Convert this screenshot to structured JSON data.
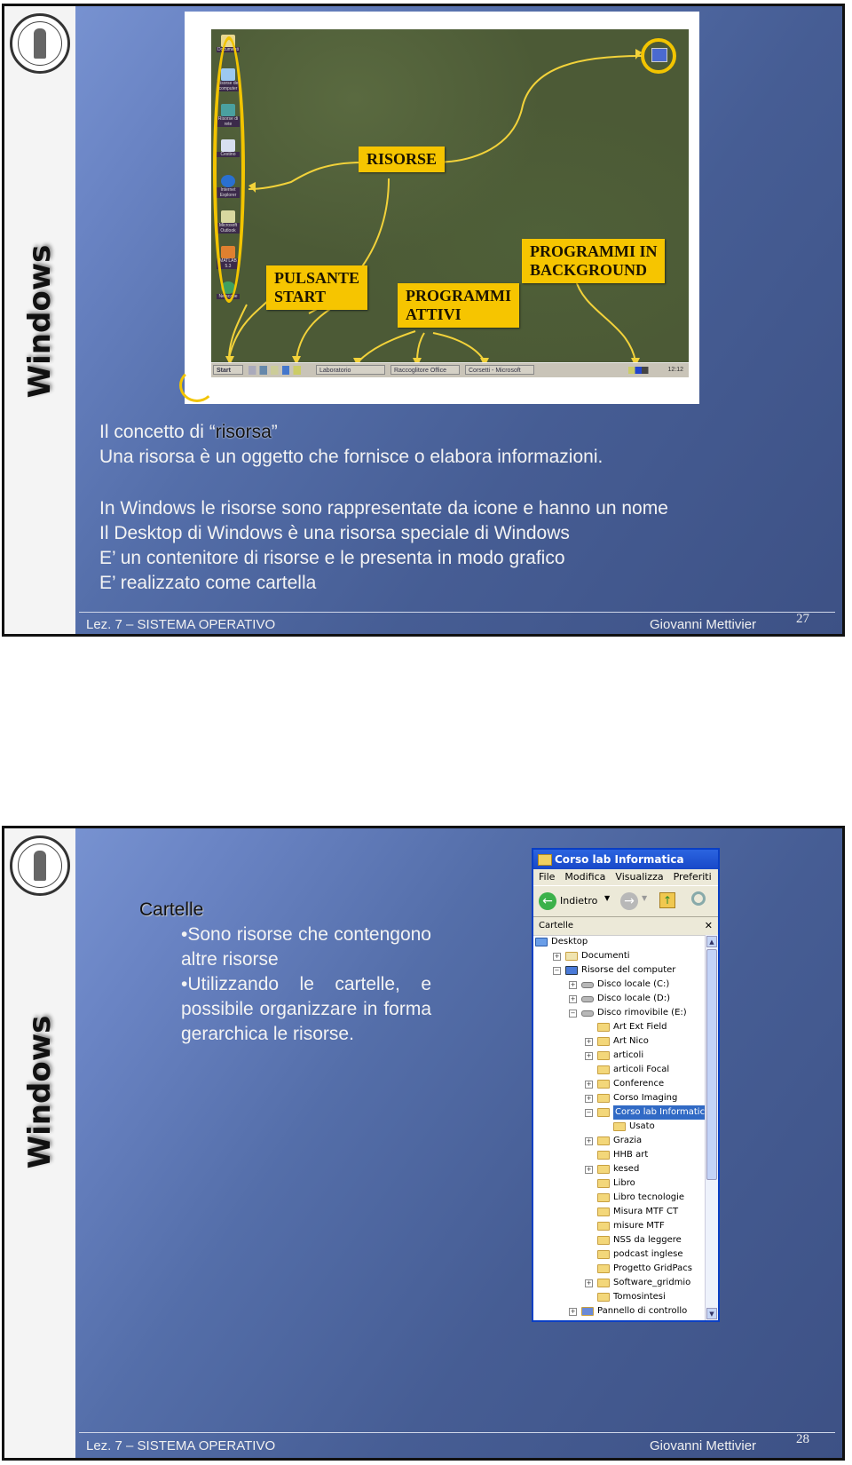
{
  "slides": [
    {
      "side_title": "Windows",
      "desktop": {
        "labels": {
          "risorse": "RISORSE",
          "pulsante_start": [
            "PULSANTE",
            "START"
          ],
          "programmi_attivi": [
            "PROGRAMMI",
            "ATTIVI"
          ],
          "programmi_background": [
            "PROGRAMMI IN",
            "BACKGROUND"
          ]
        },
        "icons": [
          "Documenti",
          "Risorse del computer",
          "Risorse di rete",
          "Cestino",
          "Internet Explorer",
          "Microsoft Outlook",
          "MATLAB 5.3",
          "Netscape"
        ],
        "taskbar": {
          "start": "Start",
          "buttons": [
            "Laboratorio",
            "Raccoglitore Office",
            "Corsetti - Microsoft"
          ],
          "clock": "12:12"
        }
      },
      "concept": {
        "prefix": "Il concetto di ",
        "open_quote": "“",
        "word": "risorsa",
        "close_quote": "”",
        "definition": "Una risorsa è un oggetto che fornisce o elabora informazioni."
      },
      "lines": [
        "In Windows le risorse sono rappresentate da icone e hanno un nome",
        "Il Desktop di Windows è una risorsa speciale di Windows",
        "E’ un contenitore di risorse e le presenta in modo grafico",
        "E’ realizzato come cartella"
      ],
      "footer": {
        "left": "Lez. 7 – SISTEMA OPERATIVO",
        "right": "Giovanni Mettivier",
        "page": "27"
      }
    },
    {
      "side_title": "Windows",
      "heading": "Cartelle",
      "bullets": [
        "•Sono risorse che contengono altre risorse",
        "•Utilizzando le cartelle, e possibile organizzare in forma gerarchica le risorse."
      ],
      "explorer": {
        "title": "Corso lab Informatica",
        "menu": [
          "File",
          "Modifica",
          "Visualizza",
          "Preferiti"
        ],
        "back_label": "Indietro",
        "pane_title": "Cartelle",
        "tree": [
          {
            "label": "Desktop",
            "level": 0,
            "expander": "",
            "icon": "desk"
          },
          {
            "label": "Documenti",
            "level": 1,
            "expander": "+",
            "icon": "docs"
          },
          {
            "label": "Risorse del computer",
            "level": 1,
            "expander": "−",
            "icon": "comp"
          },
          {
            "label": "Disco locale (C:)",
            "level": 2,
            "expander": "+",
            "icon": "drive"
          },
          {
            "label": "Disco locale (D:)",
            "level": 2,
            "expander": "+",
            "icon": "drive"
          },
          {
            "label": "Disco rimovibile (E:)",
            "level": 2,
            "expander": "−",
            "icon": "drive"
          },
          {
            "label": "Art Ext Field",
            "level": 3,
            "expander": "",
            "icon": "folder"
          },
          {
            "label": "Art Nico",
            "level": 3,
            "expander": "+",
            "icon": "folder"
          },
          {
            "label": "articoli",
            "level": 3,
            "expander": "+",
            "icon": "folder"
          },
          {
            "label": "articoli Focal",
            "level": 3,
            "expander": "",
            "icon": "folder"
          },
          {
            "label": "Conference",
            "level": 3,
            "expander": "+",
            "icon": "folder"
          },
          {
            "label": "Corso Imaging",
            "level": 3,
            "expander": "+",
            "icon": "folder"
          },
          {
            "label": "Corso lab Informatica",
            "level": 3,
            "expander": "−",
            "icon": "folder",
            "selected": true
          },
          {
            "label": "Usato",
            "level": 4,
            "expander": "",
            "icon": "folder"
          },
          {
            "label": "Grazia",
            "level": 3,
            "expander": "+",
            "icon": "folder"
          },
          {
            "label": "HHB art",
            "level": 3,
            "expander": "",
            "icon": "folder"
          },
          {
            "label": "kesed",
            "level": 3,
            "expander": "+",
            "icon": "folder"
          },
          {
            "label": "Libro",
            "level": 3,
            "expander": "",
            "icon": "folder"
          },
          {
            "label": "Libro tecnologie",
            "level": 3,
            "expander": "",
            "icon": "folder"
          },
          {
            "label": "Misura MTF CT",
            "level": 3,
            "expander": "",
            "icon": "folder"
          },
          {
            "label": "misure MTF",
            "level": 3,
            "expander": "",
            "icon": "folder"
          },
          {
            "label": "NSS da leggere",
            "level": 3,
            "expander": "",
            "icon": "folder"
          },
          {
            "label": "podcast inglese",
            "level": 3,
            "expander": "",
            "icon": "folder"
          },
          {
            "label": "Progetto GridPacs",
            "level": 3,
            "expander": "",
            "icon": "folder"
          },
          {
            "label": "Software_gridmio",
            "level": 3,
            "expander": "+",
            "icon": "folder"
          },
          {
            "label": "Tomosintesi",
            "level": 3,
            "expander": "",
            "icon": "folder"
          },
          {
            "label": "Pannello di controllo",
            "level": 2,
            "expander": "+",
            "icon": "ctrl"
          }
        ]
      },
      "footer": {
        "left": "Lez. 7 – SISTEMA OPERATIVO",
        "right": "Giovanni Mettivier",
        "page": "28"
      }
    }
  ]
}
